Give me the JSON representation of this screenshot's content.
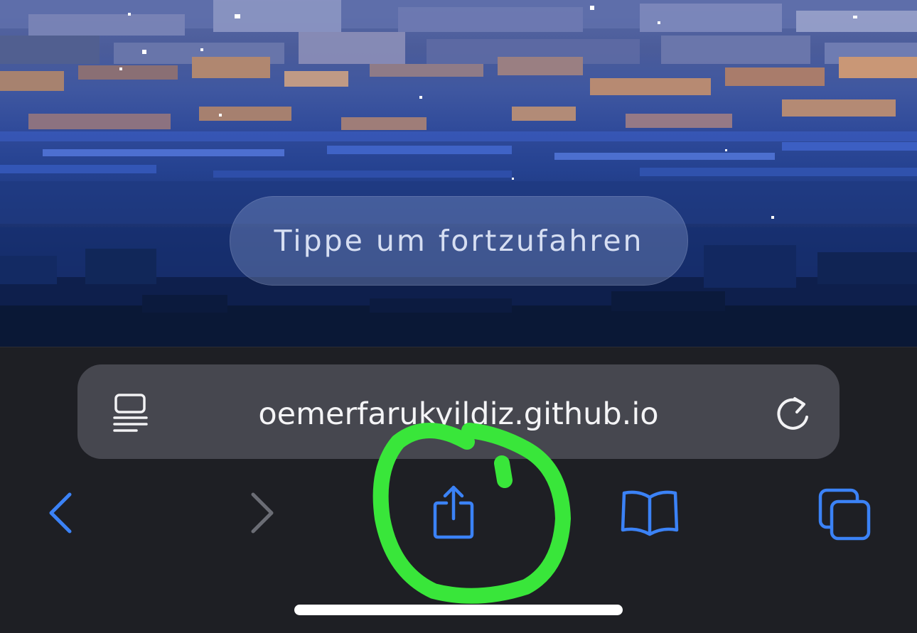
{
  "page": {
    "continue_label": "Tippe um fortzufahren"
  },
  "browser": {
    "url": "oemerfarukyildiz.github.io",
    "icons": {
      "reader": "reader-mode-icon",
      "reload": "reload-icon",
      "back": "chevron-left-icon",
      "forward": "chevron-right-icon",
      "share": "share-icon",
      "bookmarks": "open-book-icon",
      "tabs": "tabs-icon"
    },
    "accent_color": "#3b82f6",
    "disabled_color": "#6b6d75"
  },
  "annotation": {
    "color": "#39e63a",
    "target": "share-button"
  }
}
